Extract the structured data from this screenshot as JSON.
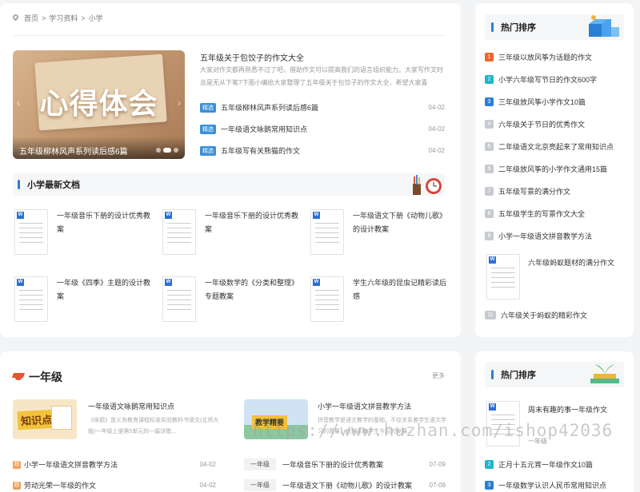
{
  "breadcrumb": [
    "首页",
    "学习资料",
    "小学"
  ],
  "hero": {
    "title": "心得体会",
    "caption": "五年级柳林风声系列读后感6篇"
  },
  "feature": {
    "title": "五年级关于包饺子的作文大全",
    "desc": "大家对作文都再熟悉不过了吧，借助作文可以提高我们的语言组织能力。大家写作文时总是无从下笔?下面小编给大家整理了五年级关于包饺子的作文大全，希望大家喜欢！..."
  },
  "news": [
    {
      "tag": "精选",
      "title": "五年级柳林风声系列读后感6篇",
      "date": "04-02"
    },
    {
      "tag": "精选",
      "title": "一年级语文咏鹅常用知识点",
      "date": "04-02"
    },
    {
      "tag": "精选",
      "title": "五年级写有关熊猫的作文",
      "date": "04-02"
    }
  ],
  "latest": {
    "title": "小学最新文档",
    "docs": [
      "一年级音乐下册的设计优秀教案",
      "一年级音乐下册的设计优秀教案",
      "一年级语文下册《动物儿歌》的设计教案",
      "一年级《四季》主题的设计教案",
      "一年级数学的《分类和整理》专题教案",
      "学生六年级的昆虫记精彩读后感"
    ]
  },
  "ranking": {
    "title": "热门排序",
    "items": [
      {
        "n": "1",
        "title": "三年级以放风筝为话题的作文"
      },
      {
        "n": "2",
        "title": "小学六年级写节日的作文600字"
      },
      {
        "n": "3",
        "title": "三年级放风筝小学作文10篇"
      },
      {
        "n": "4",
        "title": "六年级关于节日的优秀作文"
      },
      {
        "n": "5",
        "title": "二年级语文北京亮起来了常用知识点"
      },
      {
        "n": "6",
        "title": "二年级放风筝的小学作文通用15篇"
      },
      {
        "n": "7",
        "title": "五年级写景的满分作文"
      },
      {
        "n": "8",
        "title": "五年级学生的写景作文大全"
      },
      {
        "n": "9",
        "title": "小学一年级语文拼音教学方法"
      }
    ],
    "doc_item": "六年级蚂蚁题材的满分作文",
    "last": {
      "n": "11",
      "title": "六年级关于蚂蚁的精彩作文"
    }
  },
  "grade": {
    "title": "一年级",
    "more": "更多",
    "cards": [
      {
        "thumb_text": "知识点",
        "title": "一年级语文咏鹅常用知识点",
        "desc": "《咏鹅》是义务教育课程标准实验教科书语文(北师大版)一年级上册第5单元的一篇诗歌..."
      },
      {
        "thumb_text": "教学精要",
        "title": "小学一年级语文拼音教学方法",
        "desc": "拼音教学是语文教学的基础，不仅关系着学生语文学习的质量，也关系着学生今后的发展..."
      }
    ],
    "rows_left": [
      {
        "tag": "荐",
        "title": "小学一年级语文拼音教学方法",
        "date": "04-02"
      },
      {
        "tag": "荐",
        "title": "劳动光荣一年级的作文",
        "date": "04-02"
      }
    ],
    "rows_right": [
      {
        "chip": "一年级",
        "title": "一年级音乐下册的设计优秀教案",
        "date": "07-09"
      },
      {
        "chip": "一年级",
        "title": "一年级语文下册《动物儿歌》的设计教案",
        "date": "07-09"
      }
    ]
  },
  "ranking2": {
    "title": "热门排序",
    "doc_item": "周末有趣的事一年级作文",
    "doc_sub": "一年级",
    "items": [
      {
        "n": "2",
        "title": "正月十五元宵一年级作文10篇"
      },
      {
        "n": "3",
        "title": "一年级数学认识人民币常用知识点"
      }
    ]
  },
  "watermark": "https://www.huzhan.com/ishop42036"
}
